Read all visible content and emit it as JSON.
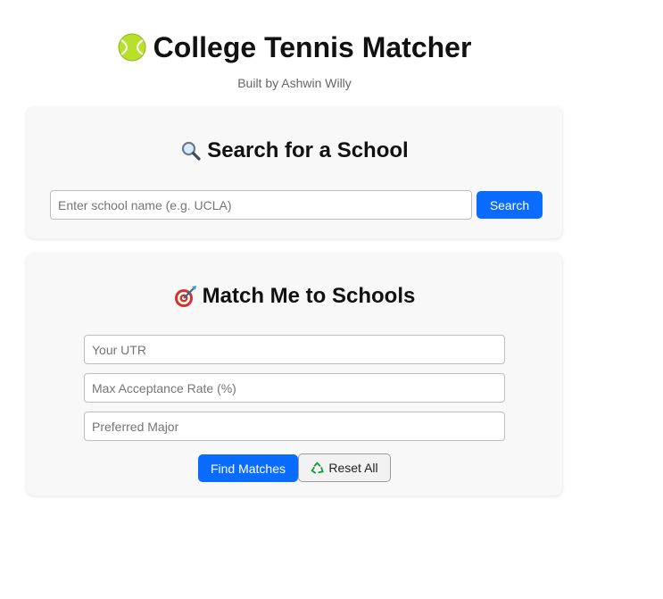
{
  "header": {
    "title": "College Tennis Matcher",
    "subtitle": "Built by Ashwin Willy",
    "title_icon": "tennis-ball-icon"
  },
  "search_card": {
    "title": "Search for a School",
    "title_icon": "magnifying-glass-icon",
    "input_placeholder": "Enter school name (e.g. UCLA)",
    "input_value": "",
    "button_label": "Search"
  },
  "match_card": {
    "title": "Match Me to Schools",
    "title_icon": "dart-target-icon",
    "fields": [
      {
        "placeholder": "Your UTR",
        "value": ""
      },
      {
        "placeholder": "Max Acceptance Rate (%)",
        "value": ""
      },
      {
        "placeholder": "Preferred Major",
        "value": ""
      }
    ],
    "find_button_label": "Find Matches",
    "reset_button_label": "Reset All",
    "reset_icon": "recycle-icon"
  },
  "colors": {
    "accent": "#0a6cff",
    "card_bg": "#f8f8f8",
    "subtitle": "#666666"
  }
}
